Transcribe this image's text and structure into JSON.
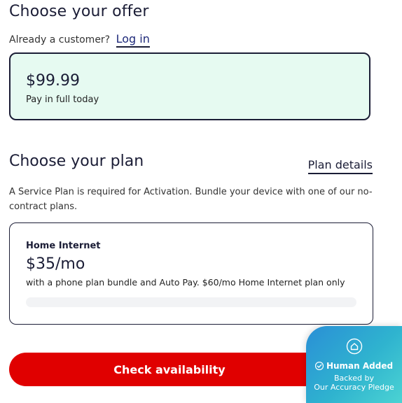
{
  "offer_section": {
    "title": "Choose your offer",
    "customer_prompt": "Already a customer?",
    "login_label": "Log in",
    "selected_offer": {
      "price": "$99.99",
      "subtitle": "Pay in full today"
    }
  },
  "plan_section": {
    "title": "Choose your plan",
    "details_link": "Plan details",
    "description": "A Service Plan is required for Activation. Bundle your device with one of our no-contract plans.",
    "plan_card": {
      "name": "Home Internet",
      "price": "$35/mo",
      "note": "with a phone plan bundle and Auto Pay. $60/mo Home Internet plan only"
    }
  },
  "cta": {
    "label": "Check availability"
  },
  "badge": {
    "title": "Human Added",
    "line1": "Backed by",
    "line2": "Our Accuracy Pledge"
  },
  "colors": {
    "accent_red": "#e00000",
    "offer_bg": "#e6faf1",
    "text_dark": "#1b1d36",
    "badge_gradient_start": "#2a8fd6",
    "badge_gradient_end": "#4bd3d3"
  },
  "icons": {
    "badge_top": "home-icon",
    "badge_check": "check-circle-icon"
  }
}
